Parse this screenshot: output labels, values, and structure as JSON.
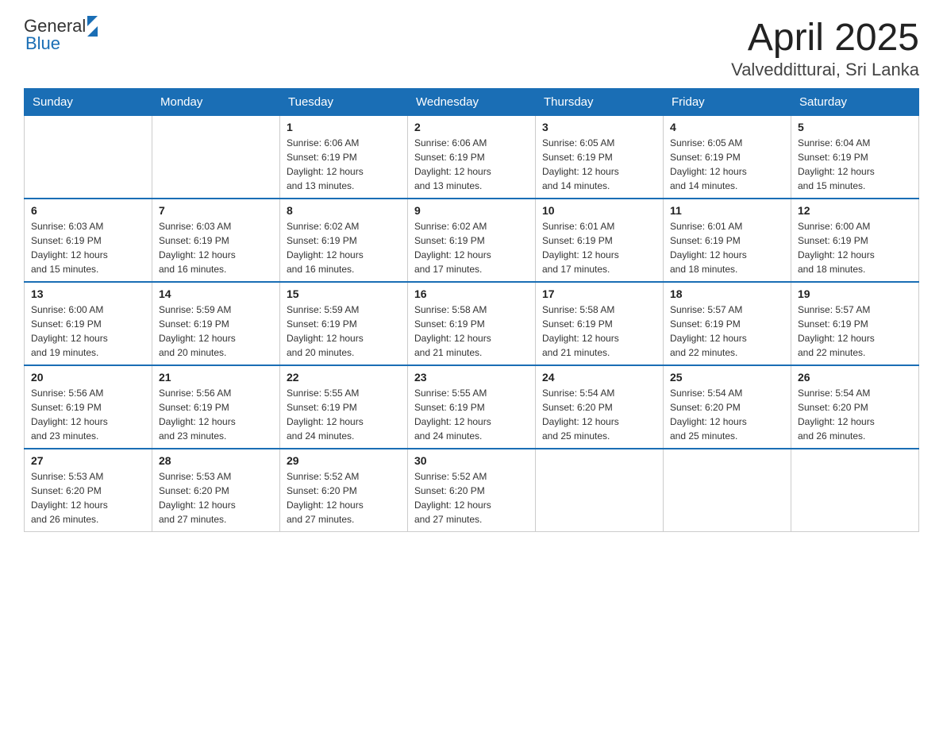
{
  "header": {
    "logo_text_general": "General",
    "logo_text_blue": "Blue",
    "title": "April 2025",
    "subtitle": "Valvedditturai, Sri Lanka"
  },
  "weekdays": [
    "Sunday",
    "Monday",
    "Tuesday",
    "Wednesday",
    "Thursday",
    "Friday",
    "Saturday"
  ],
  "weeks": [
    [
      {
        "day": "",
        "info": ""
      },
      {
        "day": "",
        "info": ""
      },
      {
        "day": "1",
        "info": "Sunrise: 6:06 AM\nSunset: 6:19 PM\nDaylight: 12 hours\nand 13 minutes."
      },
      {
        "day": "2",
        "info": "Sunrise: 6:06 AM\nSunset: 6:19 PM\nDaylight: 12 hours\nand 13 minutes."
      },
      {
        "day": "3",
        "info": "Sunrise: 6:05 AM\nSunset: 6:19 PM\nDaylight: 12 hours\nand 14 minutes."
      },
      {
        "day": "4",
        "info": "Sunrise: 6:05 AM\nSunset: 6:19 PM\nDaylight: 12 hours\nand 14 minutes."
      },
      {
        "day": "5",
        "info": "Sunrise: 6:04 AM\nSunset: 6:19 PM\nDaylight: 12 hours\nand 15 minutes."
      }
    ],
    [
      {
        "day": "6",
        "info": "Sunrise: 6:03 AM\nSunset: 6:19 PM\nDaylight: 12 hours\nand 15 minutes."
      },
      {
        "day": "7",
        "info": "Sunrise: 6:03 AM\nSunset: 6:19 PM\nDaylight: 12 hours\nand 16 minutes."
      },
      {
        "day": "8",
        "info": "Sunrise: 6:02 AM\nSunset: 6:19 PM\nDaylight: 12 hours\nand 16 minutes."
      },
      {
        "day": "9",
        "info": "Sunrise: 6:02 AM\nSunset: 6:19 PM\nDaylight: 12 hours\nand 17 minutes."
      },
      {
        "day": "10",
        "info": "Sunrise: 6:01 AM\nSunset: 6:19 PM\nDaylight: 12 hours\nand 17 minutes."
      },
      {
        "day": "11",
        "info": "Sunrise: 6:01 AM\nSunset: 6:19 PM\nDaylight: 12 hours\nand 18 minutes."
      },
      {
        "day": "12",
        "info": "Sunrise: 6:00 AM\nSunset: 6:19 PM\nDaylight: 12 hours\nand 18 minutes."
      }
    ],
    [
      {
        "day": "13",
        "info": "Sunrise: 6:00 AM\nSunset: 6:19 PM\nDaylight: 12 hours\nand 19 minutes."
      },
      {
        "day": "14",
        "info": "Sunrise: 5:59 AM\nSunset: 6:19 PM\nDaylight: 12 hours\nand 20 minutes."
      },
      {
        "day": "15",
        "info": "Sunrise: 5:59 AM\nSunset: 6:19 PM\nDaylight: 12 hours\nand 20 minutes."
      },
      {
        "day": "16",
        "info": "Sunrise: 5:58 AM\nSunset: 6:19 PM\nDaylight: 12 hours\nand 21 minutes."
      },
      {
        "day": "17",
        "info": "Sunrise: 5:58 AM\nSunset: 6:19 PM\nDaylight: 12 hours\nand 21 minutes."
      },
      {
        "day": "18",
        "info": "Sunrise: 5:57 AM\nSunset: 6:19 PM\nDaylight: 12 hours\nand 22 minutes."
      },
      {
        "day": "19",
        "info": "Sunrise: 5:57 AM\nSunset: 6:19 PM\nDaylight: 12 hours\nand 22 minutes."
      }
    ],
    [
      {
        "day": "20",
        "info": "Sunrise: 5:56 AM\nSunset: 6:19 PM\nDaylight: 12 hours\nand 23 minutes."
      },
      {
        "day": "21",
        "info": "Sunrise: 5:56 AM\nSunset: 6:19 PM\nDaylight: 12 hours\nand 23 minutes."
      },
      {
        "day": "22",
        "info": "Sunrise: 5:55 AM\nSunset: 6:19 PM\nDaylight: 12 hours\nand 24 minutes."
      },
      {
        "day": "23",
        "info": "Sunrise: 5:55 AM\nSunset: 6:19 PM\nDaylight: 12 hours\nand 24 minutes."
      },
      {
        "day": "24",
        "info": "Sunrise: 5:54 AM\nSunset: 6:20 PM\nDaylight: 12 hours\nand 25 minutes."
      },
      {
        "day": "25",
        "info": "Sunrise: 5:54 AM\nSunset: 6:20 PM\nDaylight: 12 hours\nand 25 minutes."
      },
      {
        "day": "26",
        "info": "Sunrise: 5:54 AM\nSunset: 6:20 PM\nDaylight: 12 hours\nand 26 minutes."
      }
    ],
    [
      {
        "day": "27",
        "info": "Sunrise: 5:53 AM\nSunset: 6:20 PM\nDaylight: 12 hours\nand 26 minutes."
      },
      {
        "day": "28",
        "info": "Sunrise: 5:53 AM\nSunset: 6:20 PM\nDaylight: 12 hours\nand 27 minutes."
      },
      {
        "day": "29",
        "info": "Sunrise: 5:52 AM\nSunset: 6:20 PM\nDaylight: 12 hours\nand 27 minutes."
      },
      {
        "day": "30",
        "info": "Sunrise: 5:52 AM\nSunset: 6:20 PM\nDaylight: 12 hours\nand 27 minutes."
      },
      {
        "day": "",
        "info": ""
      },
      {
        "day": "",
        "info": ""
      },
      {
        "day": "",
        "info": ""
      }
    ]
  ]
}
